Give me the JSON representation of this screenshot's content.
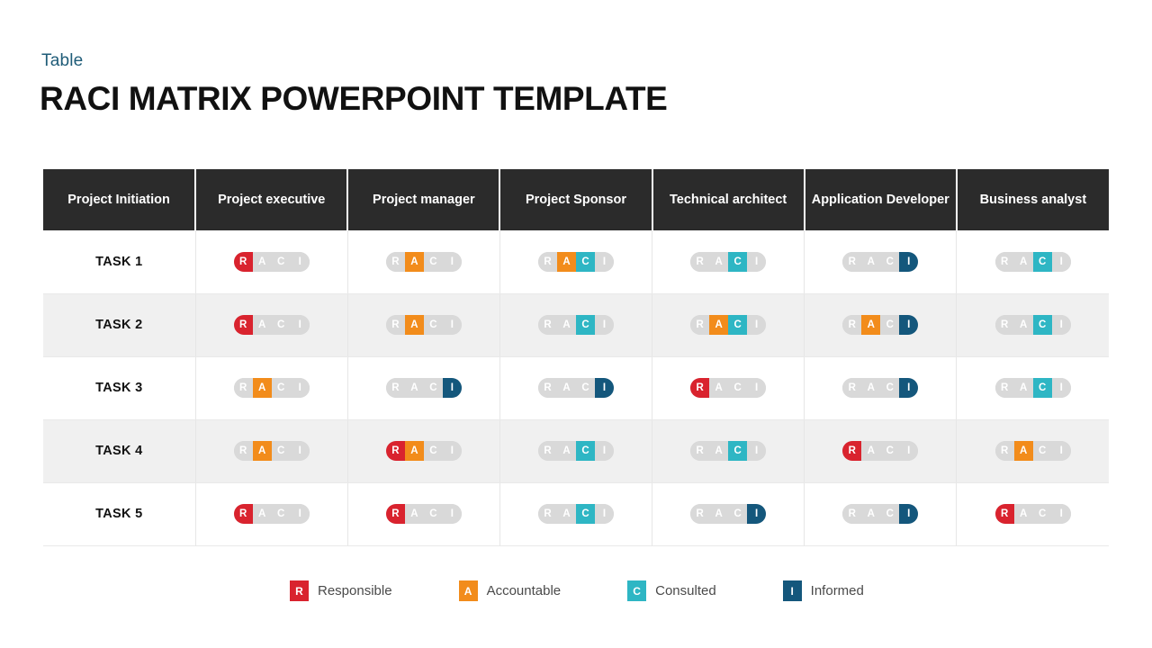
{
  "header": {
    "eyebrow": "Table",
    "title": "RACI MATRIX POWERPOINT TEMPLATE"
  },
  "colors": {
    "responsible": "#d9232e",
    "accountable": "#f28c1b",
    "consulted": "#2eb6c4",
    "informed": "#14577c",
    "pill_inactive": "#d9d9d9",
    "header_background": "#2b2b2b",
    "eyebrow_text": "#1f5c78",
    "row_stripe": "#f0f0f0"
  },
  "table": {
    "columns": [
      "Project Initiation",
      "Project executive",
      "Project manager",
      "Project Sponsor",
      "Technical architect",
      "Application Developer",
      "Business analyst"
    ],
    "roles": [
      "R",
      "A",
      "C",
      "I"
    ],
    "rows": [
      {
        "task": "TASK 1",
        "cells": [
          {
            "R": true,
            "A": false,
            "C": false,
            "I": false
          },
          {
            "R": false,
            "A": true,
            "C": false,
            "I": false
          },
          {
            "R": false,
            "A": true,
            "C": true,
            "I": false
          },
          {
            "R": false,
            "A": false,
            "C": true,
            "I": false
          },
          {
            "R": false,
            "A": false,
            "C": false,
            "I": true
          },
          {
            "R": false,
            "A": false,
            "C": true,
            "I": false
          }
        ]
      },
      {
        "task": "TASK 2",
        "cells": [
          {
            "R": true,
            "A": false,
            "C": false,
            "I": false
          },
          {
            "R": false,
            "A": true,
            "C": false,
            "I": false
          },
          {
            "R": false,
            "A": false,
            "C": true,
            "I": false
          },
          {
            "R": false,
            "A": true,
            "C": true,
            "I": false
          },
          {
            "R": false,
            "A": true,
            "C": false,
            "I": true
          },
          {
            "R": false,
            "A": false,
            "C": true,
            "I": false
          }
        ]
      },
      {
        "task": "TASK 3",
        "cells": [
          {
            "R": false,
            "A": true,
            "C": false,
            "I": false
          },
          {
            "R": false,
            "A": false,
            "C": false,
            "I": true
          },
          {
            "R": false,
            "A": false,
            "C": false,
            "I": true
          },
          {
            "R": true,
            "A": false,
            "C": false,
            "I": false
          },
          {
            "R": false,
            "A": false,
            "C": false,
            "I": true
          },
          {
            "R": false,
            "A": false,
            "C": true,
            "I": false
          }
        ]
      },
      {
        "task": "TASK 4",
        "cells": [
          {
            "R": false,
            "A": true,
            "C": false,
            "I": false
          },
          {
            "R": true,
            "A": true,
            "C": false,
            "I": false
          },
          {
            "R": false,
            "A": false,
            "C": true,
            "I": false
          },
          {
            "R": false,
            "A": false,
            "C": true,
            "I": false
          },
          {
            "R": true,
            "A": false,
            "C": false,
            "I": false
          },
          {
            "R": false,
            "A": true,
            "C": false,
            "I": false
          }
        ]
      },
      {
        "task": "TASK 5",
        "cells": [
          {
            "R": true,
            "A": false,
            "C": false,
            "I": false
          },
          {
            "R": true,
            "A": false,
            "C": false,
            "I": false
          },
          {
            "R": false,
            "A": false,
            "C": true,
            "I": false
          },
          {
            "R": false,
            "A": false,
            "C": false,
            "I": true
          },
          {
            "R": false,
            "A": false,
            "C": false,
            "I": true
          },
          {
            "R": true,
            "A": false,
            "C": false,
            "I": false
          }
        ]
      }
    ]
  },
  "legend": [
    {
      "key": "R",
      "label": "Responsible",
      "color": "#d9232e"
    },
    {
      "key": "A",
      "label": "Accountable",
      "color": "#f28c1b"
    },
    {
      "key": "C",
      "label": "Consulted",
      "color": "#2eb6c4"
    },
    {
      "key": "I",
      "label": "Informed",
      "color": "#14577c"
    }
  ]
}
